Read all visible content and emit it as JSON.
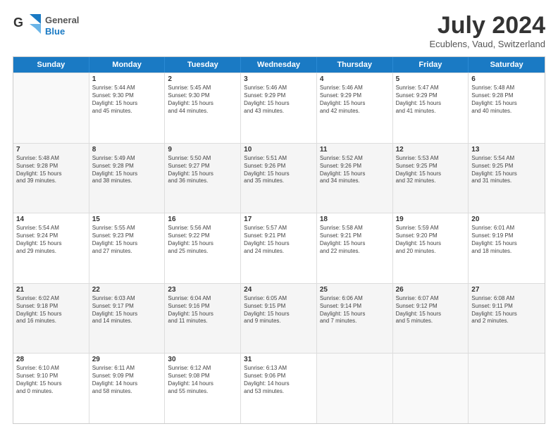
{
  "header": {
    "logo_line1": "General",
    "logo_line2": "Blue",
    "main_title": "July 2024",
    "subtitle": "Ecublens, Vaud, Switzerland"
  },
  "weekdays": [
    "Sunday",
    "Monday",
    "Tuesday",
    "Wednesday",
    "Thursday",
    "Friday",
    "Saturday"
  ],
  "rows": [
    [
      {
        "day": "",
        "info": ""
      },
      {
        "day": "1",
        "info": "Sunrise: 5:44 AM\nSunset: 9:30 PM\nDaylight: 15 hours\nand 45 minutes."
      },
      {
        "day": "2",
        "info": "Sunrise: 5:45 AM\nSunset: 9:30 PM\nDaylight: 15 hours\nand 44 minutes."
      },
      {
        "day": "3",
        "info": "Sunrise: 5:46 AM\nSunset: 9:29 PM\nDaylight: 15 hours\nand 43 minutes."
      },
      {
        "day": "4",
        "info": "Sunrise: 5:46 AM\nSunset: 9:29 PM\nDaylight: 15 hours\nand 42 minutes."
      },
      {
        "day": "5",
        "info": "Sunrise: 5:47 AM\nSunset: 9:29 PM\nDaylight: 15 hours\nand 41 minutes."
      },
      {
        "day": "6",
        "info": "Sunrise: 5:48 AM\nSunset: 9:28 PM\nDaylight: 15 hours\nand 40 minutes."
      }
    ],
    [
      {
        "day": "7",
        "info": "Sunrise: 5:48 AM\nSunset: 9:28 PM\nDaylight: 15 hours\nand 39 minutes."
      },
      {
        "day": "8",
        "info": "Sunrise: 5:49 AM\nSunset: 9:28 PM\nDaylight: 15 hours\nand 38 minutes."
      },
      {
        "day": "9",
        "info": "Sunrise: 5:50 AM\nSunset: 9:27 PM\nDaylight: 15 hours\nand 36 minutes."
      },
      {
        "day": "10",
        "info": "Sunrise: 5:51 AM\nSunset: 9:26 PM\nDaylight: 15 hours\nand 35 minutes."
      },
      {
        "day": "11",
        "info": "Sunrise: 5:52 AM\nSunset: 9:26 PM\nDaylight: 15 hours\nand 34 minutes."
      },
      {
        "day": "12",
        "info": "Sunrise: 5:53 AM\nSunset: 9:25 PM\nDaylight: 15 hours\nand 32 minutes."
      },
      {
        "day": "13",
        "info": "Sunrise: 5:54 AM\nSunset: 9:25 PM\nDaylight: 15 hours\nand 31 minutes."
      }
    ],
    [
      {
        "day": "14",
        "info": "Sunrise: 5:54 AM\nSunset: 9:24 PM\nDaylight: 15 hours\nand 29 minutes."
      },
      {
        "day": "15",
        "info": "Sunrise: 5:55 AM\nSunset: 9:23 PM\nDaylight: 15 hours\nand 27 minutes."
      },
      {
        "day": "16",
        "info": "Sunrise: 5:56 AM\nSunset: 9:22 PM\nDaylight: 15 hours\nand 25 minutes."
      },
      {
        "day": "17",
        "info": "Sunrise: 5:57 AM\nSunset: 9:21 PM\nDaylight: 15 hours\nand 24 minutes."
      },
      {
        "day": "18",
        "info": "Sunrise: 5:58 AM\nSunset: 9:21 PM\nDaylight: 15 hours\nand 22 minutes."
      },
      {
        "day": "19",
        "info": "Sunrise: 5:59 AM\nSunset: 9:20 PM\nDaylight: 15 hours\nand 20 minutes."
      },
      {
        "day": "20",
        "info": "Sunrise: 6:01 AM\nSunset: 9:19 PM\nDaylight: 15 hours\nand 18 minutes."
      }
    ],
    [
      {
        "day": "21",
        "info": "Sunrise: 6:02 AM\nSunset: 9:18 PM\nDaylight: 15 hours\nand 16 minutes."
      },
      {
        "day": "22",
        "info": "Sunrise: 6:03 AM\nSunset: 9:17 PM\nDaylight: 15 hours\nand 14 minutes."
      },
      {
        "day": "23",
        "info": "Sunrise: 6:04 AM\nSunset: 9:16 PM\nDaylight: 15 hours\nand 11 minutes."
      },
      {
        "day": "24",
        "info": "Sunrise: 6:05 AM\nSunset: 9:15 PM\nDaylight: 15 hours\nand 9 minutes."
      },
      {
        "day": "25",
        "info": "Sunrise: 6:06 AM\nSunset: 9:14 PM\nDaylight: 15 hours\nand 7 minutes."
      },
      {
        "day": "26",
        "info": "Sunrise: 6:07 AM\nSunset: 9:12 PM\nDaylight: 15 hours\nand 5 minutes."
      },
      {
        "day": "27",
        "info": "Sunrise: 6:08 AM\nSunset: 9:11 PM\nDaylight: 15 hours\nand 2 minutes."
      }
    ],
    [
      {
        "day": "28",
        "info": "Sunrise: 6:10 AM\nSunset: 9:10 PM\nDaylight: 15 hours\nand 0 minutes."
      },
      {
        "day": "29",
        "info": "Sunrise: 6:11 AM\nSunset: 9:09 PM\nDaylight: 14 hours\nand 58 minutes."
      },
      {
        "day": "30",
        "info": "Sunrise: 6:12 AM\nSunset: 9:08 PM\nDaylight: 14 hours\nand 55 minutes."
      },
      {
        "day": "31",
        "info": "Sunrise: 6:13 AM\nSunset: 9:06 PM\nDaylight: 14 hours\nand 53 minutes."
      },
      {
        "day": "",
        "info": ""
      },
      {
        "day": "",
        "info": ""
      },
      {
        "day": "",
        "info": ""
      }
    ]
  ]
}
